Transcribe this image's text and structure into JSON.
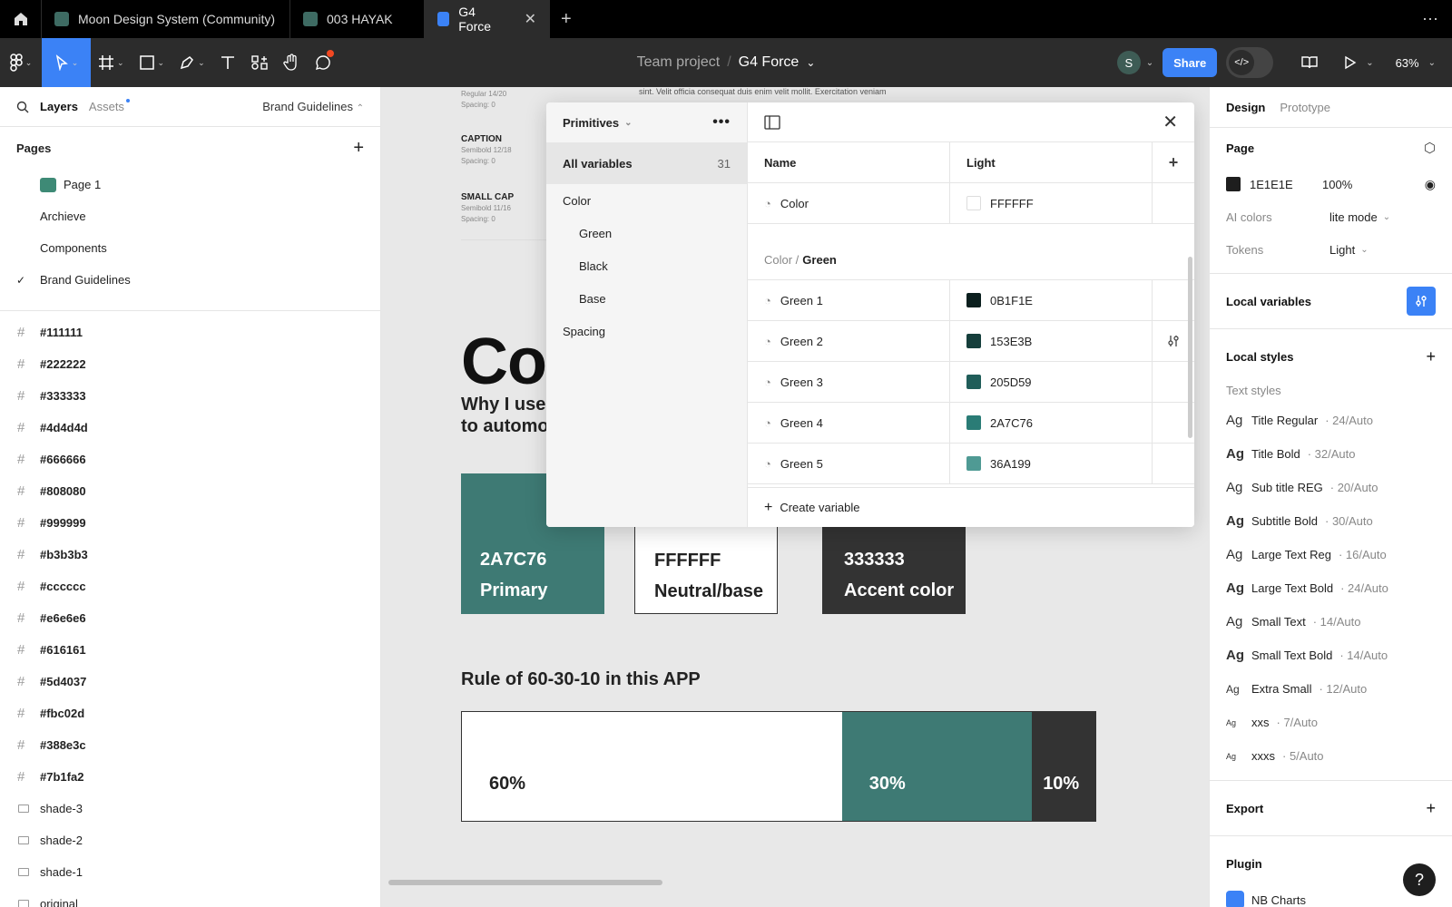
{
  "tabs": [
    {
      "label": "Moon Design System (Community)"
    },
    {
      "label": "003 HAYAK"
    },
    {
      "label": "G4 Force",
      "active": true
    }
  ],
  "toolbar": {
    "team": "Team project",
    "separator": "/",
    "file": "G4 Force",
    "avatar": "S",
    "share": "Share",
    "zoom": "63%"
  },
  "left": {
    "tab_layers": "Layers",
    "tab_assets": "Assets",
    "current_page": "Brand Guidelines",
    "pages_title": "Pages",
    "pages": [
      "Page 1",
      "Archieve",
      "Components",
      "Brand Guidelines"
    ],
    "layers": [
      "#111111",
      "#222222",
      "#333333",
      "#4d4d4d",
      "#666666",
      "#808080",
      "#999999",
      "#b3b3b3",
      "#cccccc",
      "#e6e6e6",
      "#616161",
      "#5d4037",
      "#fbc02d",
      "#388e3c",
      "#7b1fa2"
    ],
    "frames": [
      "shade-3",
      "shade-2",
      "shade-1",
      "original"
    ]
  },
  "canvas": {
    "typo": [
      {
        "name": "",
        "meta1": "Regular 14/20",
        "meta2": "Spacing: 0"
      },
      {
        "name": "CAPTION",
        "meta1": "Semibold 12/18",
        "meta2": "Spacing: 0"
      },
      {
        "name": "SMALL CAP",
        "meta1": "Semibold 11/16",
        "meta2": "Spacing: 0"
      }
    ],
    "body_sample": "sint. Velit officia consequat duis enim velit mollit. Exercitation veniam",
    "big": "Co",
    "why1": "Why I use",
    "why2": "to automo",
    "swatches": [
      {
        "code": "2A7C76",
        "label": "Primary",
        "bg": "#3e7a74",
        "fg": "#ffffff"
      },
      {
        "code": "FFFFFF",
        "label": "Neutral/base",
        "bg": "#ffffff",
        "fg": "#222222"
      },
      {
        "code": "333333",
        "label": "Accent color",
        "bg": "#333333",
        "fg": "#ffffff"
      }
    ],
    "rule_title": "Rule of 60-30-10 in this APP",
    "rule_parts": [
      {
        "label": "60%",
        "pct": 60,
        "bg": "#ffffff",
        "fg": "#222222"
      },
      {
        "label": "30%",
        "pct": 30,
        "bg": "#3e7a74",
        "fg": "#ffffff"
      },
      {
        "label": "10%",
        "pct": 10,
        "bg": "#333333",
        "fg": "#ffffff"
      }
    ]
  },
  "variables": {
    "collection": "Primitives",
    "all_label": "All variables",
    "all_count": "31",
    "groups": [
      {
        "label": "Color",
        "sub": false
      },
      {
        "label": "Green",
        "sub": true
      },
      {
        "label": "Black",
        "sub": true
      },
      {
        "label": "Base",
        "sub": true
      },
      {
        "label": "Spacing",
        "sub": false
      }
    ],
    "col_name": "Name",
    "col_mode": "Light",
    "top_row": {
      "name": "Color",
      "value": "FFFFFF",
      "color": "#ffffff"
    },
    "group_path": "Color /",
    "group_name": "Green",
    "rows": [
      {
        "name": "Green 1",
        "value": "0B1F1E",
        "color": "#0b1f1e"
      },
      {
        "name": "Green 2",
        "value": "153E3B",
        "color": "#153e3b"
      },
      {
        "name": "Green 3",
        "value": "205D59",
        "color": "#205d59"
      },
      {
        "name": "Green 4",
        "value": "2A7C76",
        "color": "#2a7c76"
      },
      {
        "name": "Green 5",
        "value": "36A199",
        "color": "#4f9a94"
      }
    ],
    "create": "Create variable"
  },
  "right": {
    "tab_design": "Design",
    "tab_prototype": "Prototype",
    "page_title": "Page",
    "page_color": "1E1E1E",
    "page_opacity": "100%",
    "ai_label": "AI colors",
    "ai_value": "lite mode",
    "tokens_label": "Tokens",
    "tokens_value": "Light",
    "local_vars": "Local variables",
    "local_styles": "Local styles",
    "text_styles": "Text styles",
    "styles": [
      {
        "name": "Title Regular",
        "meta": "· 24/Auto",
        "bold": false
      },
      {
        "name": "Title Bold",
        "meta": "· 32/Auto",
        "bold": true
      },
      {
        "name": "Sub title REG",
        "meta": "· 20/Auto",
        "bold": false
      },
      {
        "name": "Subtitle Bold",
        "meta": "· 30/Auto",
        "bold": true
      },
      {
        "name": "Large Text Reg",
        "meta": "· 16/Auto",
        "bold": false
      },
      {
        "name": "Large Text Bold",
        "meta": "· 24/Auto",
        "bold": true
      },
      {
        "name": "Small Text",
        "meta": "· 14/Auto",
        "bold": false
      },
      {
        "name": "Small Text Bold",
        "meta": "· 14/Auto",
        "bold": true
      },
      {
        "name": "Extra Small",
        "meta": "· 12/Auto",
        "bold": false
      },
      {
        "name": "xxs",
        "meta": "· 7/Auto",
        "bold": false
      },
      {
        "name": "xxxs",
        "meta": "· 5/Auto",
        "bold": false
      }
    ],
    "export": "Export",
    "plugin": "Plugin",
    "plugin_name": "NB Charts",
    "help": "?"
  }
}
